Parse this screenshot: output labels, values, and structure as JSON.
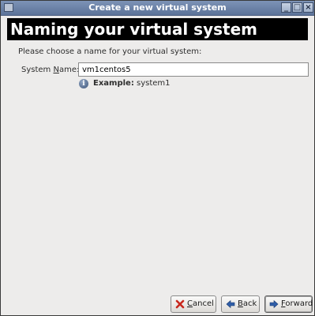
{
  "window": {
    "title": "Create a new virtual system",
    "controls": {
      "minimize": "_",
      "maximize": "□",
      "close": "×"
    }
  },
  "banner": {
    "title": "Naming your virtual system"
  },
  "form": {
    "prompt": "Please choose a name for your virtual system:",
    "name_label_before": "System ",
    "name_label_mnemonic": "N",
    "name_label_after": "ame:",
    "name_value": "vm1centos5",
    "example_label": "Example:",
    "example_value": " system1"
  },
  "buttons": {
    "cancel": {
      "pre": "",
      "mnemonic": "C",
      "post": "ancel",
      "icon": "cancel-icon"
    },
    "back": {
      "pre": "",
      "mnemonic": "B",
      "post": "ack",
      "icon": "back-arrow-icon"
    },
    "forward": {
      "pre": "",
      "mnemonic": "F",
      "post": "orward",
      "icon": "forward-arrow-icon"
    }
  },
  "colors": {
    "titlebar": "#6b82a8",
    "banner_bg": "#000000",
    "window_bg": "#edeceb",
    "cancel_x": "#c8281e",
    "arrow_blue": "#2f5ea8"
  }
}
